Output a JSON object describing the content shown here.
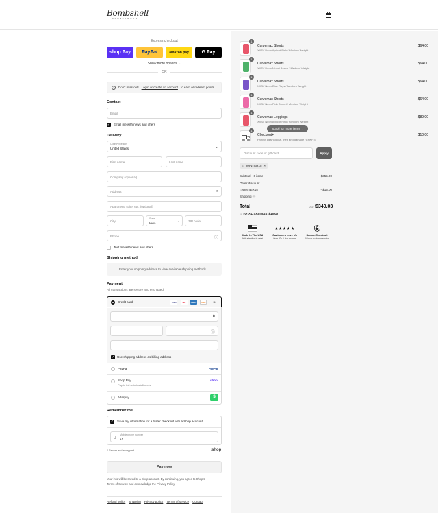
{
  "header": {
    "brand_name": "Bombshell",
    "brand_sub": "SPORTSWEAR"
  },
  "express": {
    "label": "Express checkout",
    "buttons": {
      "shop": "shop Pay",
      "paypal": "PayPal",
      "amazon": "amazon pay",
      "gpay": "G Pay"
    },
    "show_more": "Show more options",
    "or": "OR"
  },
  "notice": {
    "prefix": "Don't miss out!",
    "link": "Login or create an account",
    "suffix": "to earn or redeem points."
  },
  "contact": {
    "title": "Contact",
    "email_placeholder": "Email",
    "email_news_label": "Email me with news and offers"
  },
  "delivery": {
    "title": "Delivery",
    "country_label": "Country/Region",
    "country_value": "United States",
    "first_name": "First name",
    "last_name": "Last name",
    "company": "Company (optional)",
    "address": "Address",
    "apartment": "Apartment, suite, etc. (optional)",
    "city": "City",
    "state_label": "State",
    "state_value": "Iowa",
    "zip": "ZIP code",
    "phone": "Phone",
    "text_news_label": "Text me with news and offers"
  },
  "shipping": {
    "title": "Shipping method",
    "message": "Enter your shipping address to view available shipping methods."
  },
  "payment": {
    "title": "Payment",
    "subtitle": "All transactions are secure and encrypted.",
    "credit_card": "Credit card",
    "card_logos": [
      "VISA",
      "MC",
      "AMEX",
      "DISC"
    ],
    "more_cards": "+4",
    "billing_label": "Use shipping address as billing address",
    "paypal": "PayPal",
    "paypal_logo": "PayPal",
    "shoppay": "Shop Pay",
    "shoppay_sub": "Pay in full or in installments",
    "shoppay_logo": "shop",
    "afterpay": "Afterpay",
    "afterpay_logo": "$"
  },
  "remember": {
    "title": "Remember me",
    "save_label": "Save my information for a faster checkout with a Shop account",
    "mobile_label": "Mobile phone number",
    "mobile_value": "+1",
    "secure_label": "Secure and encrypted",
    "shop_logo": "shop"
  },
  "pay_now": "Pay now",
  "disclaimer": {
    "line1": "Your info will be saved to a Shop account. By continuing, you agree to Shop's",
    "terms": "Terms of Service",
    "mid": "and acknowledge the",
    "privacy": "Privacy Policy",
    "end": "."
  },
  "footer_links": [
    "Refund policy",
    "Shipping",
    "Privacy policy",
    "Terms of service",
    "Contact"
  ],
  "cart": {
    "items": [
      {
        "qty": "1",
        "name": "Curvemax Shorts",
        "variant": "XXS / Neon Apricot Pink / Medium Weight",
        "price": "$64.00",
        "color": "#e8566a"
      },
      {
        "qty": "1",
        "name": "Curvemax Shorts",
        "variant": "XXS / Neon Miami Beach / Medium Weight",
        "price": "$64.00",
        "color": "#4fb36b"
      },
      {
        "qty": "1",
        "name": "Curvemax Shorts",
        "variant": "XXS / Neon Blue Rays / Medium Weight",
        "price": "$64.00",
        "color": "#7a55c9"
      },
      {
        "qty": "1",
        "name": "Curvemax Shorts",
        "variant": "XXS / Neon Pink Sorbet / Medium Weight",
        "price": "$64.00",
        "color": "#ec6aa8"
      },
      {
        "qty": "1",
        "name": "Curvemax Leggings",
        "variant": "XXS / Neon Apricot Pink / Medium Weight",
        "price": "$89.00",
        "color": "#e8566a"
      },
      {
        "qty": "1",
        "name": "Checkout+",
        "variant": "Protect against loss, theft and damage (CHKPT)",
        "price": "$10.00",
        "color": "#ffffff"
      }
    ],
    "scroll_hint": "Scroll for more items",
    "discount_placeholder": "Discount code or gift card",
    "apply": "Apply",
    "applied_code": "WINTER15",
    "subtotal_label": "Subtotal · 6 items",
    "subtotal_value": "$355.00",
    "order_discount_label": "Order discount",
    "discount_code": "WINTER15",
    "discount_value": "- $15.00",
    "shipping_label": "Shipping",
    "total_label": "Total",
    "currency": "USD",
    "total_value": "$340.03",
    "savings_label": "TOTAL SAVINGS",
    "savings_value": "$15.00"
  },
  "badges": [
    {
      "title": "Made In The USA",
      "sub": "With attention to detail"
    },
    {
      "title": "Customers Love Us",
      "sub": "Over 20k 5-star reviews",
      "stars": "★★★★★"
    },
    {
      "title": "Secure Checkout",
      "sub": "24 hour customer service"
    }
  ]
}
